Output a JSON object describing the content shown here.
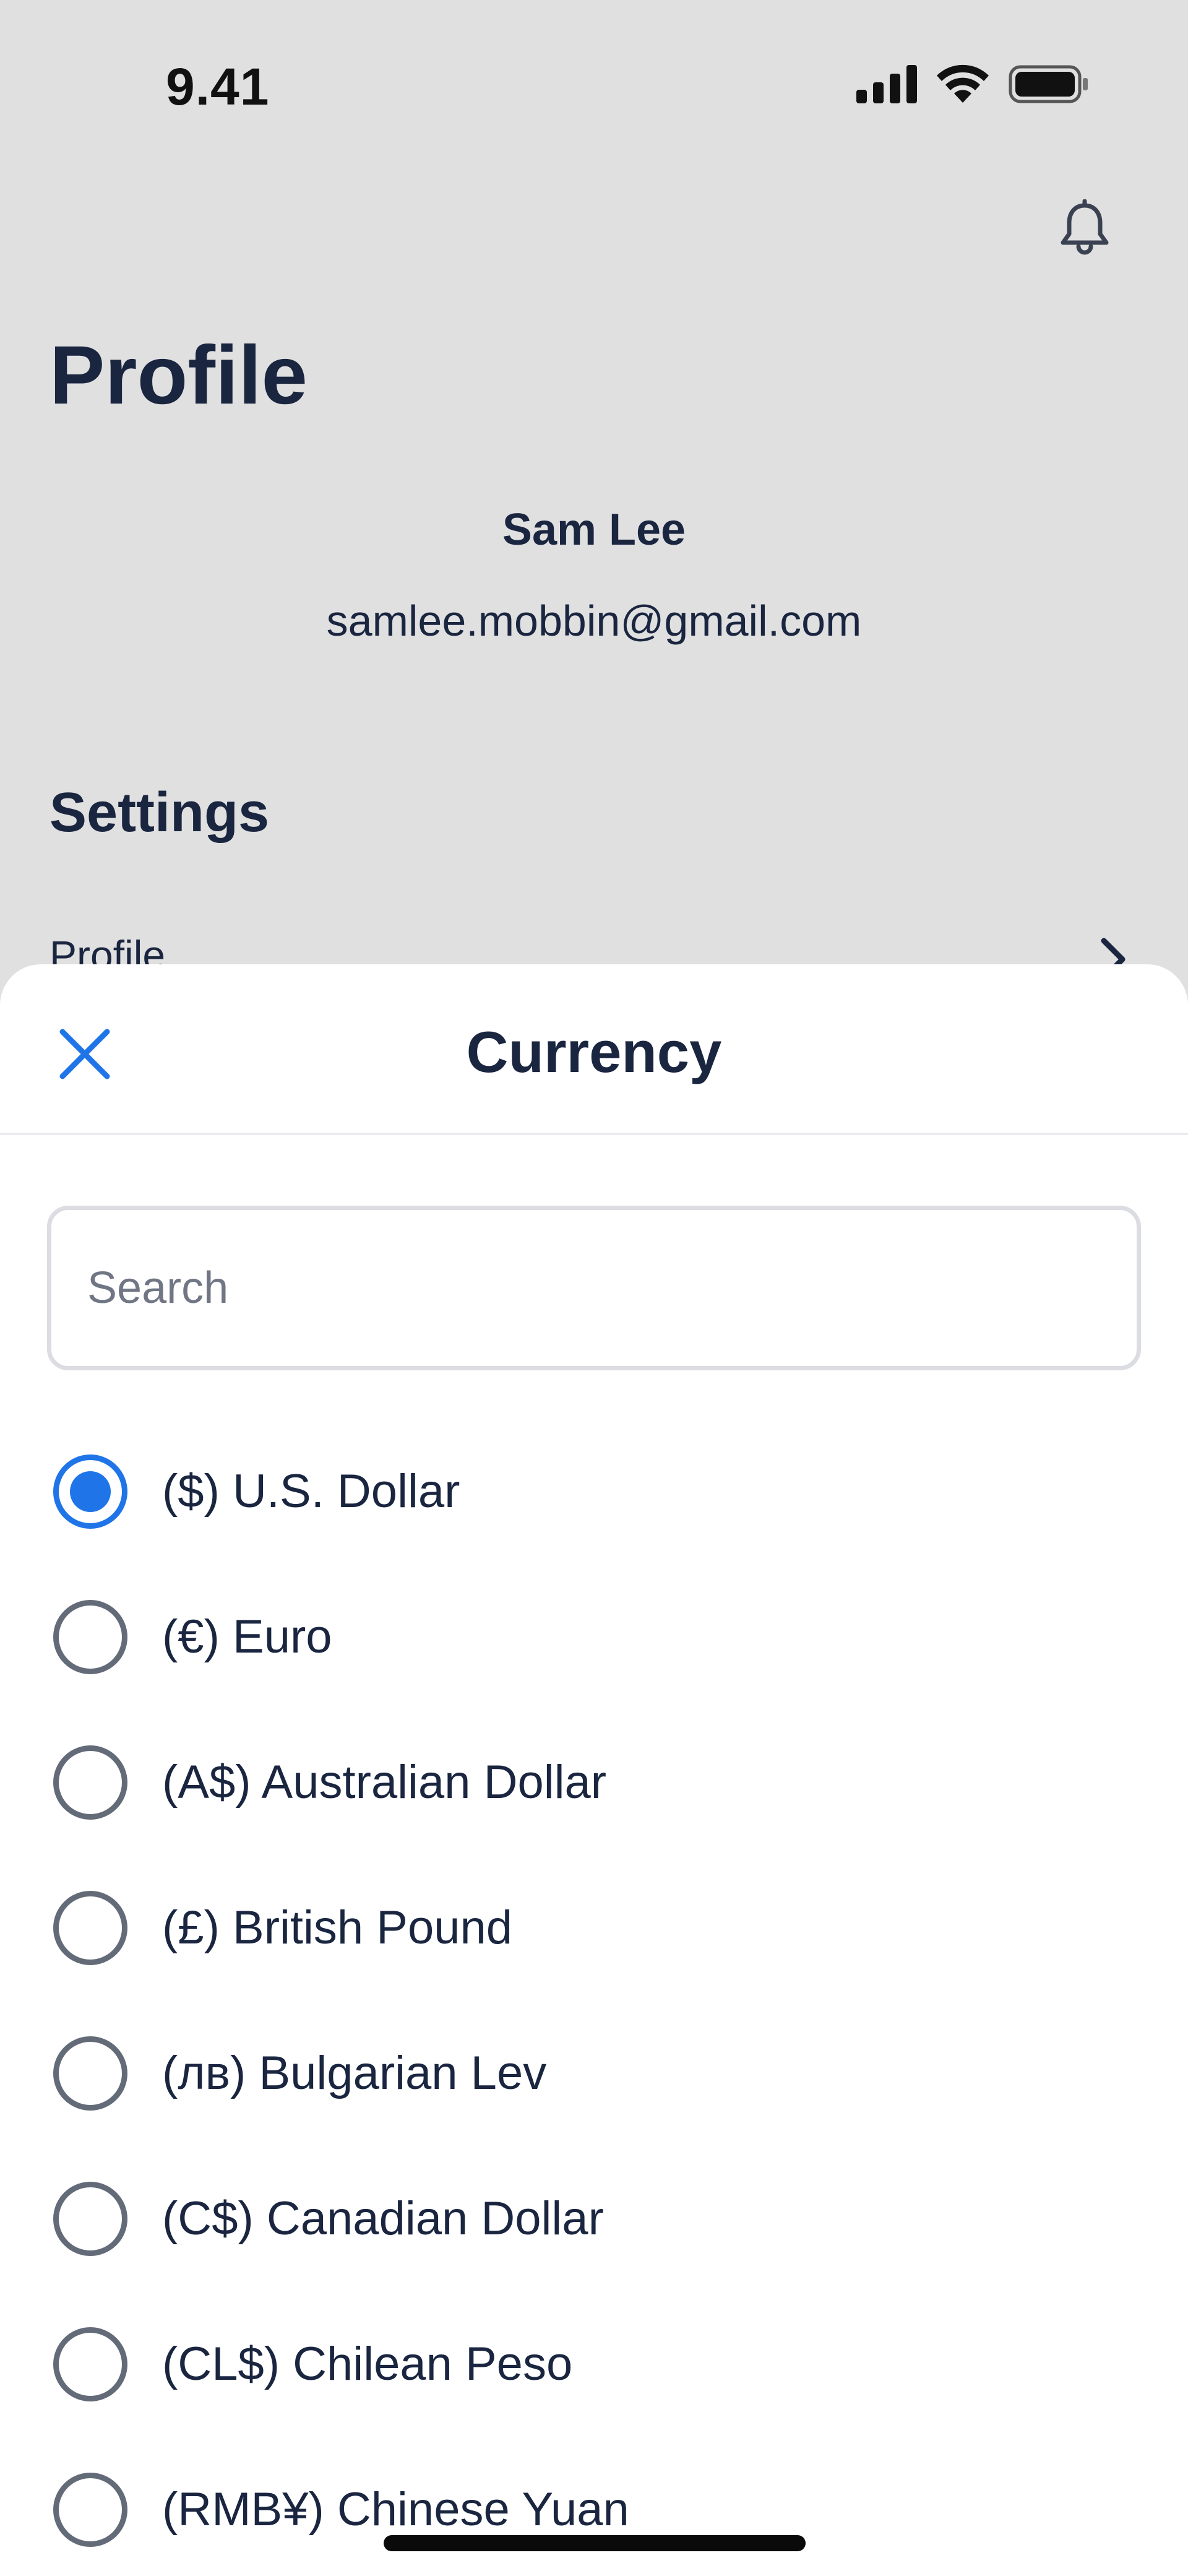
{
  "status_bar": {
    "time": "9.41",
    "icons": [
      "cellular-signal-icon",
      "wifi-icon",
      "battery-icon"
    ]
  },
  "background": {
    "page_title": "Profile",
    "user_name": "Sam Lee",
    "user_email": "samlee.mobbin@gmail.com",
    "section_title": "Settings",
    "first_row_label": "Profile"
  },
  "sheet": {
    "title": "Currency",
    "search_placeholder": "Search",
    "search_value": "",
    "currencies": [
      {
        "label": "($) U.S. Dollar",
        "selected": true
      },
      {
        "label": "(€) Euro",
        "selected": false
      },
      {
        "label": "(A$) Australian Dollar",
        "selected": false
      },
      {
        "label": "(£) British Pound",
        "selected": false
      },
      {
        "label": "(лв) Bulgarian Lev",
        "selected": false
      },
      {
        "label": "(C$) Canadian Dollar",
        "selected": false
      },
      {
        "label": "(CL$) Chilean Peso",
        "selected": false
      },
      {
        "label": "(RMB¥) Chinese Yuan",
        "selected": false
      }
    ]
  },
  "colors": {
    "accent": "#1f75e8",
    "text_primary": "#1a2540",
    "backdrop": "#e0e0e0",
    "radio_unselected": "#646b78"
  }
}
